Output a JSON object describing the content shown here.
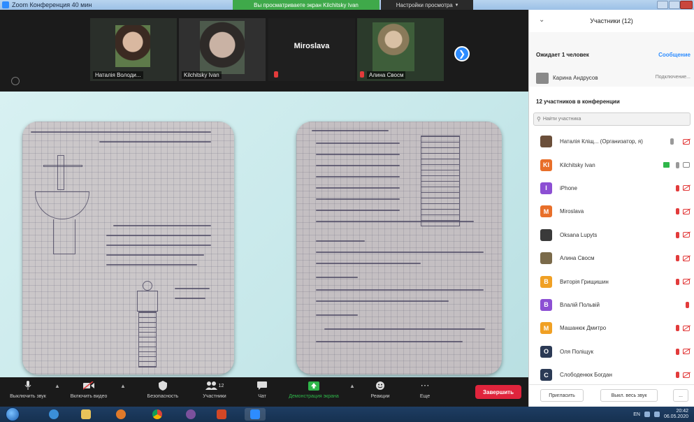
{
  "window": {
    "title": "Zoom Конференция 40 мин",
    "share_banner": "Вы просматриваете экран Kilchitsky Ivan",
    "share_settings": "Настройки просмотра"
  },
  "video_strip": {
    "tiles": [
      {
        "name": "Наталія Володи..."
      },
      {
        "name": "Kilchitsky Ivan"
      },
      {
        "name": "Miroslava"
      },
      {
        "name": "Алина Свосм"
      }
    ],
    "next_icon": "chevron-right-icon"
  },
  "toolbar": {
    "mute": "Выключить звук",
    "video": "Включить видео",
    "security": "Безопасность",
    "participants": "Участники",
    "participants_count": "12",
    "chat": "Чат",
    "share_screen": "Демонстрация экрана",
    "reactions": "Реакции",
    "more": "Еще",
    "end": "Завершить"
  },
  "panel": {
    "title": "Участники (12)",
    "waiting_title": "Ожидает 1 человек",
    "message": "Сообщение",
    "waiting_person": "Карина Андрусов",
    "admit": "Подключение...",
    "in_conference": "12 участников в конференции",
    "search_placeholder": "Найти участника",
    "participants": [
      {
        "initial": "",
        "color": "#6b4f3a",
        "name": "Наталія Кліщ... (Организатор, я)"
      },
      {
        "initial": "KI",
        "color": "#e86f2a",
        "name": "Kilchitsky Ivan"
      },
      {
        "initial": "I",
        "color": "#8c4fd3",
        "name": "iPhone"
      },
      {
        "initial": "M",
        "color": "#e86f2a",
        "name": "Miroslava"
      },
      {
        "initial": "",
        "color": "#3a3a3a",
        "name": "Oksana Lupyts"
      },
      {
        "initial": "",
        "color": "#7a6a4a",
        "name": "Алина Свосм"
      },
      {
        "initial": "В",
        "color": "#f0a024",
        "name": "Виторія Грищишин"
      },
      {
        "initial": "В",
        "color": "#8c4fd3",
        "name": "Влалій Польвій"
      },
      {
        "initial": "М",
        "color": "#f0a024",
        "name": "Машанюк Дмитро"
      },
      {
        "initial": "О",
        "color": "#2b3a55",
        "name": "Оля Поліщук"
      },
      {
        "initial": "С",
        "color": "#2b3a55",
        "name": "Слободенюк Богдан"
      }
    ],
    "invite": "Пригласить",
    "mute_all": "Выкл. весь звук",
    "more": "..."
  },
  "taskbar": {
    "time": "20:42",
    "date": "06.05.2020",
    "lang": "EN"
  }
}
